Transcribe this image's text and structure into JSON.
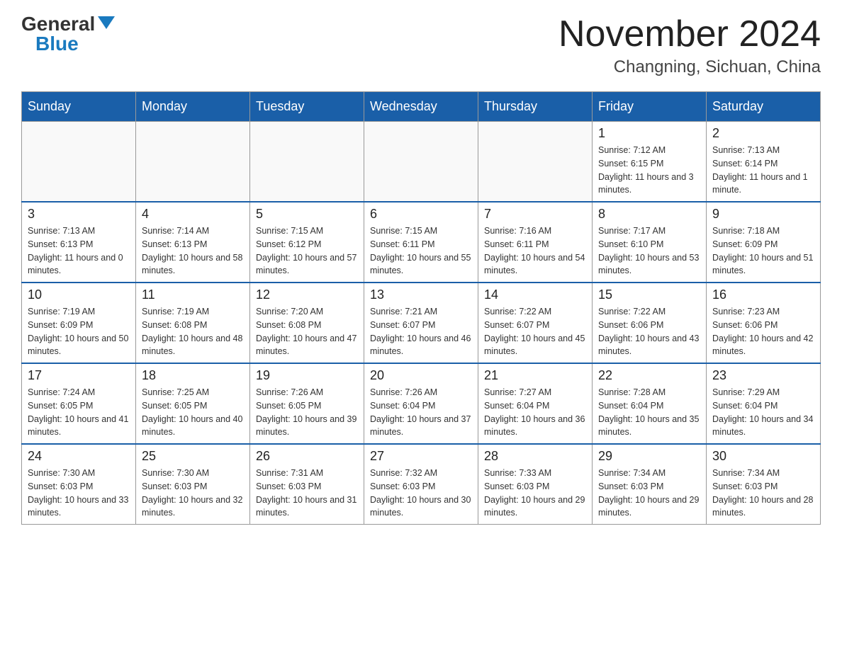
{
  "header": {
    "logo_general": "General",
    "logo_blue": "Blue",
    "month_title": "November 2024",
    "location": "Changning, Sichuan, China"
  },
  "weekdays": [
    "Sunday",
    "Monday",
    "Tuesday",
    "Wednesday",
    "Thursday",
    "Friday",
    "Saturday"
  ],
  "weeks": [
    [
      {
        "day": "",
        "info": ""
      },
      {
        "day": "",
        "info": ""
      },
      {
        "day": "",
        "info": ""
      },
      {
        "day": "",
        "info": ""
      },
      {
        "day": "",
        "info": ""
      },
      {
        "day": "1",
        "info": "Sunrise: 7:12 AM\nSunset: 6:15 PM\nDaylight: 11 hours and 3 minutes."
      },
      {
        "day": "2",
        "info": "Sunrise: 7:13 AM\nSunset: 6:14 PM\nDaylight: 11 hours and 1 minute."
      }
    ],
    [
      {
        "day": "3",
        "info": "Sunrise: 7:13 AM\nSunset: 6:13 PM\nDaylight: 11 hours and 0 minutes."
      },
      {
        "day": "4",
        "info": "Sunrise: 7:14 AM\nSunset: 6:13 PM\nDaylight: 10 hours and 58 minutes."
      },
      {
        "day": "5",
        "info": "Sunrise: 7:15 AM\nSunset: 6:12 PM\nDaylight: 10 hours and 57 minutes."
      },
      {
        "day": "6",
        "info": "Sunrise: 7:15 AM\nSunset: 6:11 PM\nDaylight: 10 hours and 55 minutes."
      },
      {
        "day": "7",
        "info": "Sunrise: 7:16 AM\nSunset: 6:11 PM\nDaylight: 10 hours and 54 minutes."
      },
      {
        "day": "8",
        "info": "Sunrise: 7:17 AM\nSunset: 6:10 PM\nDaylight: 10 hours and 53 minutes."
      },
      {
        "day": "9",
        "info": "Sunrise: 7:18 AM\nSunset: 6:09 PM\nDaylight: 10 hours and 51 minutes."
      }
    ],
    [
      {
        "day": "10",
        "info": "Sunrise: 7:19 AM\nSunset: 6:09 PM\nDaylight: 10 hours and 50 minutes."
      },
      {
        "day": "11",
        "info": "Sunrise: 7:19 AM\nSunset: 6:08 PM\nDaylight: 10 hours and 48 minutes."
      },
      {
        "day": "12",
        "info": "Sunrise: 7:20 AM\nSunset: 6:08 PM\nDaylight: 10 hours and 47 minutes."
      },
      {
        "day": "13",
        "info": "Sunrise: 7:21 AM\nSunset: 6:07 PM\nDaylight: 10 hours and 46 minutes."
      },
      {
        "day": "14",
        "info": "Sunrise: 7:22 AM\nSunset: 6:07 PM\nDaylight: 10 hours and 45 minutes."
      },
      {
        "day": "15",
        "info": "Sunrise: 7:22 AM\nSunset: 6:06 PM\nDaylight: 10 hours and 43 minutes."
      },
      {
        "day": "16",
        "info": "Sunrise: 7:23 AM\nSunset: 6:06 PM\nDaylight: 10 hours and 42 minutes."
      }
    ],
    [
      {
        "day": "17",
        "info": "Sunrise: 7:24 AM\nSunset: 6:05 PM\nDaylight: 10 hours and 41 minutes."
      },
      {
        "day": "18",
        "info": "Sunrise: 7:25 AM\nSunset: 6:05 PM\nDaylight: 10 hours and 40 minutes."
      },
      {
        "day": "19",
        "info": "Sunrise: 7:26 AM\nSunset: 6:05 PM\nDaylight: 10 hours and 39 minutes."
      },
      {
        "day": "20",
        "info": "Sunrise: 7:26 AM\nSunset: 6:04 PM\nDaylight: 10 hours and 37 minutes."
      },
      {
        "day": "21",
        "info": "Sunrise: 7:27 AM\nSunset: 6:04 PM\nDaylight: 10 hours and 36 minutes."
      },
      {
        "day": "22",
        "info": "Sunrise: 7:28 AM\nSunset: 6:04 PM\nDaylight: 10 hours and 35 minutes."
      },
      {
        "day": "23",
        "info": "Sunrise: 7:29 AM\nSunset: 6:04 PM\nDaylight: 10 hours and 34 minutes."
      }
    ],
    [
      {
        "day": "24",
        "info": "Sunrise: 7:30 AM\nSunset: 6:03 PM\nDaylight: 10 hours and 33 minutes."
      },
      {
        "day": "25",
        "info": "Sunrise: 7:30 AM\nSunset: 6:03 PM\nDaylight: 10 hours and 32 minutes."
      },
      {
        "day": "26",
        "info": "Sunrise: 7:31 AM\nSunset: 6:03 PM\nDaylight: 10 hours and 31 minutes."
      },
      {
        "day": "27",
        "info": "Sunrise: 7:32 AM\nSunset: 6:03 PM\nDaylight: 10 hours and 30 minutes."
      },
      {
        "day": "28",
        "info": "Sunrise: 7:33 AM\nSunset: 6:03 PM\nDaylight: 10 hours and 29 minutes."
      },
      {
        "day": "29",
        "info": "Sunrise: 7:34 AM\nSunset: 6:03 PM\nDaylight: 10 hours and 29 minutes."
      },
      {
        "day": "30",
        "info": "Sunrise: 7:34 AM\nSunset: 6:03 PM\nDaylight: 10 hours and 28 minutes."
      }
    ]
  ]
}
